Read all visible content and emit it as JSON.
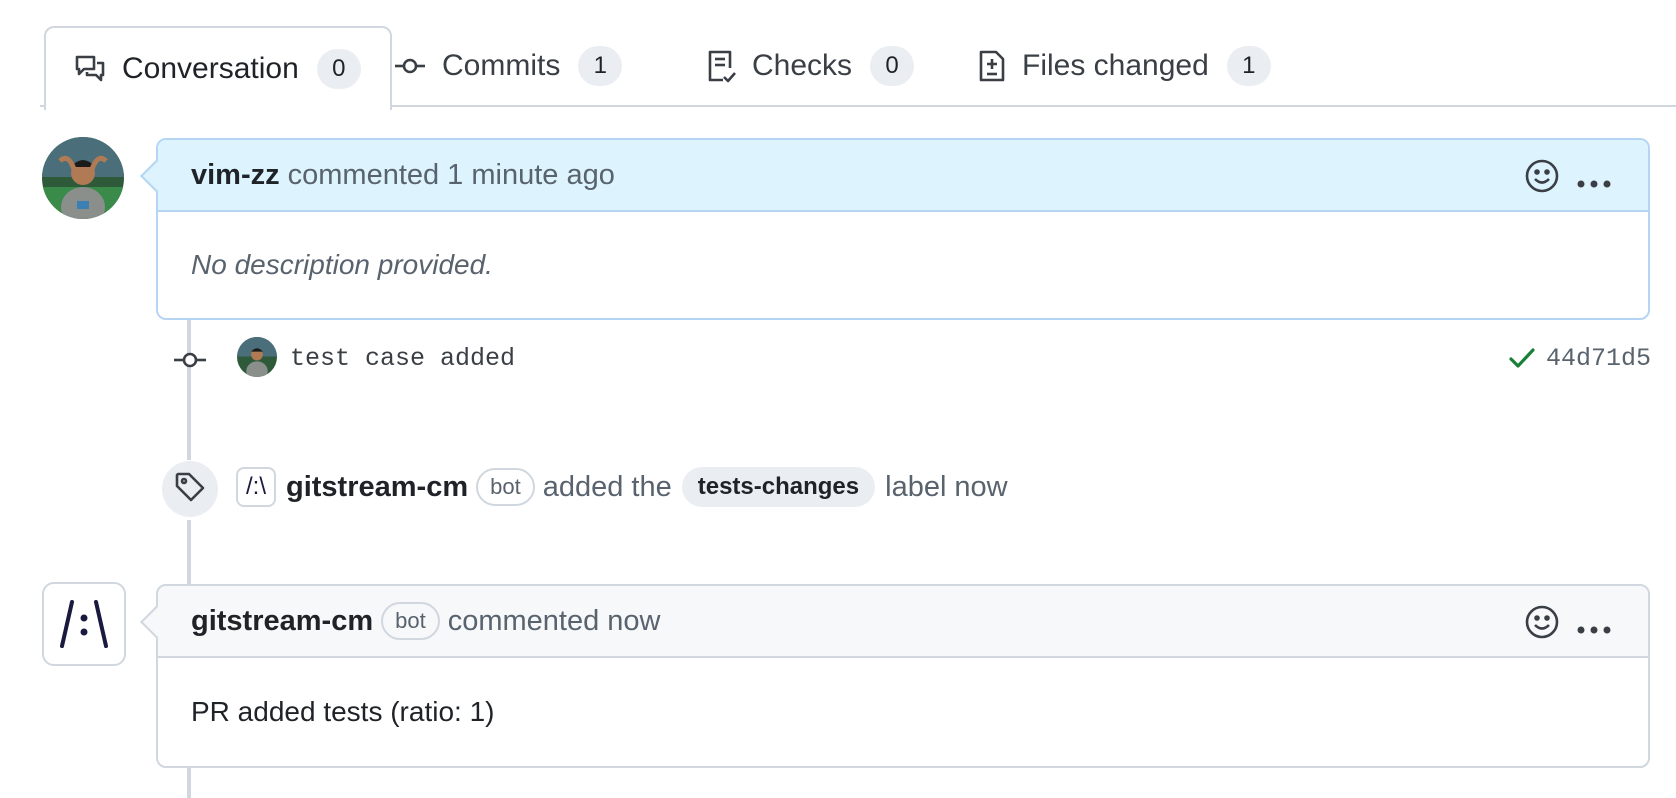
{
  "tabs": [
    {
      "label": "Conversation",
      "count": "0",
      "icon": "comment-discussion-icon"
    },
    {
      "label": "Commits",
      "count": "1",
      "icon": "git-commit-icon"
    },
    {
      "label": "Checks",
      "count": "0",
      "icon": "checklist-icon"
    },
    {
      "label": "Files changed",
      "count": "1",
      "icon": "file-diff-icon"
    }
  ],
  "first_comment": {
    "author": "vim-zz",
    "action": "commented",
    "time": "1 minute ago",
    "body": "No description provided."
  },
  "commit": {
    "message": "test case added",
    "sha": "44d71d5",
    "status": "success"
  },
  "label_event": {
    "actor": "gitstream-cm",
    "bot_badge": "bot",
    "text_before": "added the",
    "label": "tests-changes",
    "text_after": "label",
    "time": "now"
  },
  "second_comment": {
    "author": "gitstream-cm",
    "bot_badge": "bot",
    "action": "commented",
    "time": "now",
    "body": "PR added tests (ratio: 1)"
  },
  "logo_text": "/:\\",
  "colors": {
    "border": "#d0d7de",
    "blue_header": "#ddf4ff",
    "check": "#1a7f37"
  }
}
